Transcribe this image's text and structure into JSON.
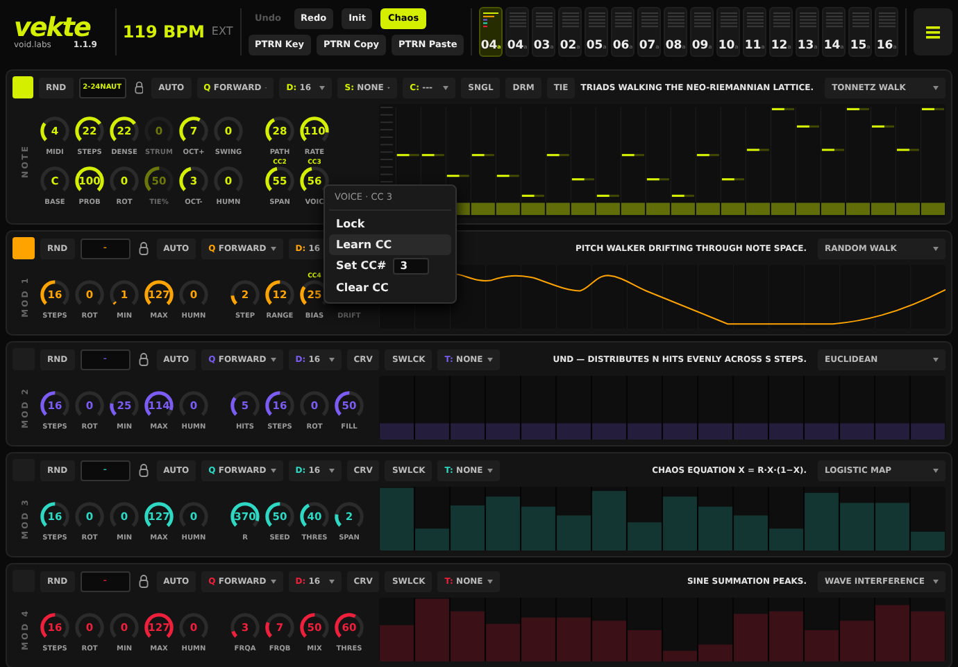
{
  "header": {
    "logo": "vekte",
    "brand": "void.labs",
    "version": "1.1.9",
    "tempo": "119 BPM",
    "clock": "EXT",
    "buttons": [
      {
        "label": "Undo",
        "disabled": true,
        "on": false
      },
      {
        "label": "Redo",
        "disabled": false,
        "on": false
      },
      {
        "label": "Init",
        "disabled": false,
        "on": false
      },
      {
        "label": "Chaos",
        "disabled": false,
        "on": true
      }
    ],
    "pattern_buttons": [
      "PTRN Key",
      "PTRN Copy",
      "PTRN Paste"
    ],
    "patterns": [
      {
        "label": "04",
        "variant": "a",
        "selected": true
      },
      {
        "label": "04",
        "variant": "a",
        "selected": false
      },
      {
        "label": "03",
        "variant": "a",
        "selected": false
      },
      {
        "label": "02",
        "variant": "a",
        "selected": false
      },
      {
        "label": "05",
        "variant": "a",
        "selected": false
      },
      {
        "label": "06",
        "variant": "a",
        "selected": false
      },
      {
        "label": "07",
        "variant": "a",
        "selected": false
      },
      {
        "label": "08",
        "variant": "a",
        "selected": false
      },
      {
        "label": "09",
        "variant": "a",
        "selected": false
      },
      {
        "label": "10",
        "variant": "a",
        "selected": false
      },
      {
        "label": "11",
        "variant": "a",
        "selected": false
      },
      {
        "label": "12",
        "variant": "a",
        "selected": false
      },
      {
        "label": "13",
        "variant": "a",
        "selected": false
      },
      {
        "label": "14",
        "variant": "a",
        "selected": false
      },
      {
        "label": "15",
        "variant": "a",
        "selected": false
      },
      {
        "label": "16",
        "variant": "a",
        "selected": false
      }
    ]
  },
  "tracks": [
    {
      "name": "NOTE",
      "color": "#d4f000",
      "active": true,
      "kind": "roll",
      "description": "TRIADS WALKING THE NEO-RIEMANNIAN LATTICE.",
      "algorithm": "TONNETZ WALK",
      "toolbar": [
        {
          "kind": "button",
          "label": "RND"
        },
        {
          "kind": "field",
          "value": "2-24NAUT"
        },
        {
          "kind": "lock"
        },
        {
          "kind": "button",
          "label": "AUTO"
        },
        {
          "kind": "select",
          "prefix": "Q",
          "value": "FORWARD"
        },
        {
          "kind": "select",
          "prefix": "D:",
          "value": "16"
        },
        {
          "kind": "select",
          "prefix": "S:",
          "value": "NONE"
        },
        {
          "kind": "select",
          "prefix": "C:",
          "value": "---"
        },
        {
          "kind": "button",
          "label": "SNGL"
        },
        {
          "kind": "button",
          "label": "DRM"
        },
        {
          "kind": "button",
          "label": "TIE"
        }
      ],
      "knob_rows": [
        {
          "left": [
            {
              "label": "MIDI",
              "value": "4",
              "dim": false
            },
            {
              "label": "STEPS",
              "value": "22",
              "dim": false
            },
            {
              "label": "DENSE",
              "value": "22",
              "dim": false
            },
            {
              "label": "STRUM",
              "value": "0",
              "dim": true
            },
            {
              "label": "OCT+",
              "value": "7",
              "dim": false
            },
            {
              "label": "SWING",
              "value": "0",
              "dim": false
            }
          ],
          "right": [
            {
              "label": "PATH",
              "value": "28",
              "dim": false
            },
            {
              "label": "RATE",
              "value": "110",
              "dim": false
            }
          ]
        },
        {
          "left": [
            {
              "label": "BASE",
              "value": "C",
              "dim": false
            },
            {
              "label": "PROB",
              "value": "100",
              "dim": false
            },
            {
              "label": "ROT",
              "value": "0",
              "dim": false
            },
            {
              "label": "TIE%",
              "value": "50",
              "dim": true
            },
            {
              "label": "OCT-",
              "value": "3",
              "dim": false
            },
            {
              "label": "HUMN",
              "value": "0",
              "dim": false
            }
          ],
          "right": [
            {
              "label": "SPAN",
              "value": "55",
              "dim": false,
              "cc": "CC2"
            },
            {
              "label": "VOIC",
              "value": "56",
              "dim": false,
              "cc": "CC3"
            }
          ]
        }
      ]
    },
    {
      "name": "MOD 1",
      "color": "#ffa300",
      "active": true,
      "kind": "curve",
      "description": "PITCH WALKER DRIFTING THROUGH NOTE SPACE.",
      "algorithm": "RANDOM WALK",
      "toolbar": [
        {
          "kind": "button",
          "label": "RND"
        },
        {
          "kind": "field",
          "value": "–"
        },
        {
          "kind": "lock"
        },
        {
          "kind": "button",
          "label": "AUTO"
        },
        {
          "kind": "select",
          "prefix": "Q",
          "value": "FORWARD"
        },
        {
          "kind": "select",
          "prefix": "D:",
          "value": "16"
        }
      ],
      "knob_rows": [
        {
          "left": [
            {
              "label": "STEPS",
              "value": "16",
              "dim": false
            },
            {
              "label": "ROT",
              "value": "0",
              "dim": false
            },
            {
              "label": "MIN",
              "value": "1",
              "dim": false
            },
            {
              "label": "MAX",
              "value": "127",
              "dim": false
            },
            {
              "label": "HUMN",
              "value": "0",
              "dim": false
            }
          ],
          "right": [
            {
              "label": "STEP",
              "value": "2",
              "dim": false
            },
            {
              "label": "RANGE",
              "value": "12",
              "dim": false
            },
            {
              "label": "BIAS",
              "value": "25",
              "dim": false,
              "cc": "CC4"
            },
            {
              "label": "DRIFT",
              "dim": true
            }
          ]
        }
      ]
    },
    {
      "name": "MOD 2",
      "color": "#7b5cf5",
      "active": false,
      "kind": "bars",
      "description": "UND — DISTRIBUTES N HITS EVENLY ACROSS S STEPS.",
      "algorithm": "EUCLIDEAN",
      "toolbar": [
        {
          "kind": "button",
          "label": "RND"
        },
        {
          "kind": "field",
          "value": "–"
        },
        {
          "kind": "lock"
        },
        {
          "kind": "button",
          "label": "AUTO"
        },
        {
          "kind": "select",
          "prefix": "Q",
          "value": "FORWARD"
        },
        {
          "kind": "select",
          "prefix": "D:",
          "value": "16"
        },
        {
          "kind": "button",
          "label": "CRV"
        },
        {
          "kind": "button",
          "label": "SWLCK"
        },
        {
          "kind": "select",
          "prefix": "T:",
          "value": "NONE"
        }
      ],
      "knob_rows": [
        {
          "left": [
            {
              "label": "STEPS",
              "value": "16",
              "dim": false
            },
            {
              "label": "ROT",
              "value": "0",
              "dim": false
            },
            {
              "label": "MIN",
              "value": "25",
              "dim": false
            },
            {
              "label": "MAX",
              "value": "114",
              "dim": false
            },
            {
              "label": "HUMN",
              "value": "0",
              "dim": false
            }
          ],
          "right": [
            {
              "label": "HITS",
              "value": "5",
              "dim": false
            },
            {
              "label": "STEPS",
              "value": "16",
              "dim": false
            },
            {
              "label": "ROT",
              "value": "0",
              "dim": false
            },
            {
              "label": "FILL",
              "value": "50",
              "dim": false
            }
          ]
        }
      ]
    },
    {
      "name": "MOD 3",
      "color": "#2ed8c3",
      "active": false,
      "kind": "bars",
      "description": "CHAOS EQUATION X = R·X·(1−X).",
      "algorithm": "LOGISTIC MAP",
      "toolbar": [
        {
          "kind": "button",
          "label": "RND"
        },
        {
          "kind": "field",
          "value": "–"
        },
        {
          "kind": "lock"
        },
        {
          "kind": "button",
          "label": "AUTO"
        },
        {
          "kind": "select",
          "prefix": "Q",
          "value": "FORWARD"
        },
        {
          "kind": "select",
          "prefix": "D:",
          "value": "16"
        },
        {
          "kind": "button",
          "label": "CRV"
        },
        {
          "kind": "button",
          "label": "SWLCK"
        },
        {
          "kind": "select",
          "prefix": "T:",
          "value": "NONE"
        }
      ],
      "knob_rows": [
        {
          "left": [
            {
              "label": "STEPS",
              "value": "16",
              "dim": false
            },
            {
              "label": "ROT",
              "value": "0",
              "dim": false
            },
            {
              "label": "MIN",
              "value": "0",
              "dim": false
            },
            {
              "label": "MAX",
              "value": "127",
              "dim": false
            },
            {
              "label": "HUMN",
              "value": "0",
              "dim": false
            }
          ],
          "right": [
            {
              "label": "R",
              "value": "370",
              "dim": false
            },
            {
              "label": "SEED",
              "value": "50",
              "dim": false
            },
            {
              "label": "THRES",
              "value": "40",
              "dim": false
            },
            {
              "label": "SPAN",
              "value": "2",
              "dim": false
            }
          ]
        }
      ]
    },
    {
      "name": "MOD 4",
      "color": "#f0203c",
      "active": false,
      "kind": "bars",
      "description": "SINE SUMMATION PEAKS.",
      "algorithm": "WAVE INTERFERENCE",
      "toolbar": [
        {
          "kind": "button",
          "label": "RND"
        },
        {
          "kind": "field",
          "value": "–"
        },
        {
          "kind": "lock"
        },
        {
          "kind": "button",
          "label": "AUTO"
        },
        {
          "kind": "select",
          "prefix": "Q",
          "value": "FORWARD"
        },
        {
          "kind": "select",
          "prefix": "D:",
          "value": "16"
        },
        {
          "kind": "button",
          "label": "CRV"
        },
        {
          "kind": "button",
          "label": "SWLCK"
        },
        {
          "kind": "select",
          "prefix": "T:",
          "value": "NONE"
        }
      ],
      "knob_rows": [
        {
          "left": [
            {
              "label": "STEPS",
              "value": "16",
              "dim": false
            },
            {
              "label": "ROT",
              "value": "0",
              "dim": false
            },
            {
              "label": "MIN",
              "value": "0",
              "dim": false
            },
            {
              "label": "MAX",
              "value": "127",
              "dim": false
            },
            {
              "label": "HUMN",
              "value": "0",
              "dim": false
            }
          ],
          "right": [
            {
              "label": "FRQA",
              "value": "3",
              "dim": false
            },
            {
              "label": "FRQB",
              "value": "7",
              "dim": false
            },
            {
              "label": "MIX",
              "value": "50",
              "dim": false
            },
            {
              "label": "THRES",
              "value": "60",
              "dim": false
            }
          ]
        }
      ]
    }
  ],
  "context_menu": {
    "title": "VOICE · CC 3",
    "items": [
      {
        "kind": "action",
        "label": "Lock",
        "selected": false
      },
      {
        "kind": "action",
        "label": "Learn CC",
        "selected": true
      },
      {
        "kind": "input",
        "label": "Set CC#",
        "value": "3",
        "selected": false
      },
      {
        "kind": "action",
        "label": "Clear CC",
        "selected": false
      }
    ]
  }
}
